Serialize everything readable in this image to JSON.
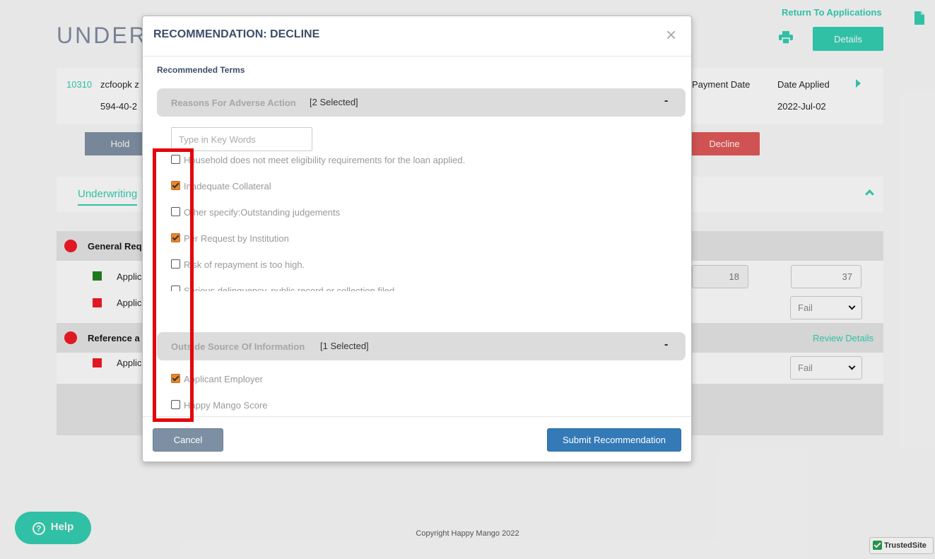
{
  "page": {
    "return_link": "Return To Applications",
    "title": "UNDERW",
    "details_label": "Details",
    "applicant": {
      "id": "10310",
      "name": "zcfoopk z",
      "ssn": "594-40-2",
      "payment_date_label": "Payment Date",
      "date_applied_label": "Date Applied",
      "date_applied_value": "2022-Jul-02"
    },
    "hold_label": "Hold",
    "decline_label": "Decline",
    "tab_underwriting": "Underwriting",
    "sections": {
      "general": {
        "title": "General Req",
        "rows": [
          {
            "label": "Applic",
            "status_color": "#1a7f1a",
            "num1": "18",
            "num2": "37"
          },
          {
            "label": "Applic",
            "status_color": "#f2131f",
            "select": "Fail"
          }
        ]
      },
      "reference": {
        "title": "Reference a",
        "review_link": "Review Details",
        "rows": [
          {
            "label": "Applic",
            "status_color": "#f2131f",
            "select": "Fail"
          }
        ]
      }
    },
    "copyright": "Copyright Happy Mango 2022",
    "help_label": "Help",
    "trusted_label": "TrustedSite"
  },
  "modal": {
    "title": "RECOMMENDATION: DECLINE",
    "close": "×",
    "recommended_terms": "Recommended Terms",
    "adverse": {
      "title": "Reasons For Adverse Action",
      "count": "[2 Selected]",
      "toggle": "-",
      "search_placeholder": "Type in Key Words",
      "options": [
        {
          "label": "Household does not meet eligibility requirements for the loan applied.",
          "checked": false
        },
        {
          "label": "Inadequate Collateral",
          "checked": true
        },
        {
          "label": "Other specify:Outstanding judgements",
          "checked": false
        },
        {
          "label": "Per Request by Institution",
          "checked": true
        },
        {
          "label": "Risk of repayment is too high.",
          "checked": false
        },
        {
          "label": "Serious delinquency, public record or collection filed",
          "checked": false
        }
      ]
    },
    "outside": {
      "title": "Outside Source Of Information",
      "count": "[1 Selected]",
      "toggle": "-",
      "options": [
        {
          "label": "Applicant Employer",
          "checked": true
        },
        {
          "label": "Happy Mango Score",
          "checked": false
        }
      ]
    },
    "cancel_label": "Cancel",
    "submit_label": "Submit Recommendation"
  },
  "colors": {
    "accent": "#2ecfb0",
    "decline": "#e05454",
    "primary": "#337ab7",
    "highlight": "#e4050b",
    "checked": "#e8862d"
  }
}
